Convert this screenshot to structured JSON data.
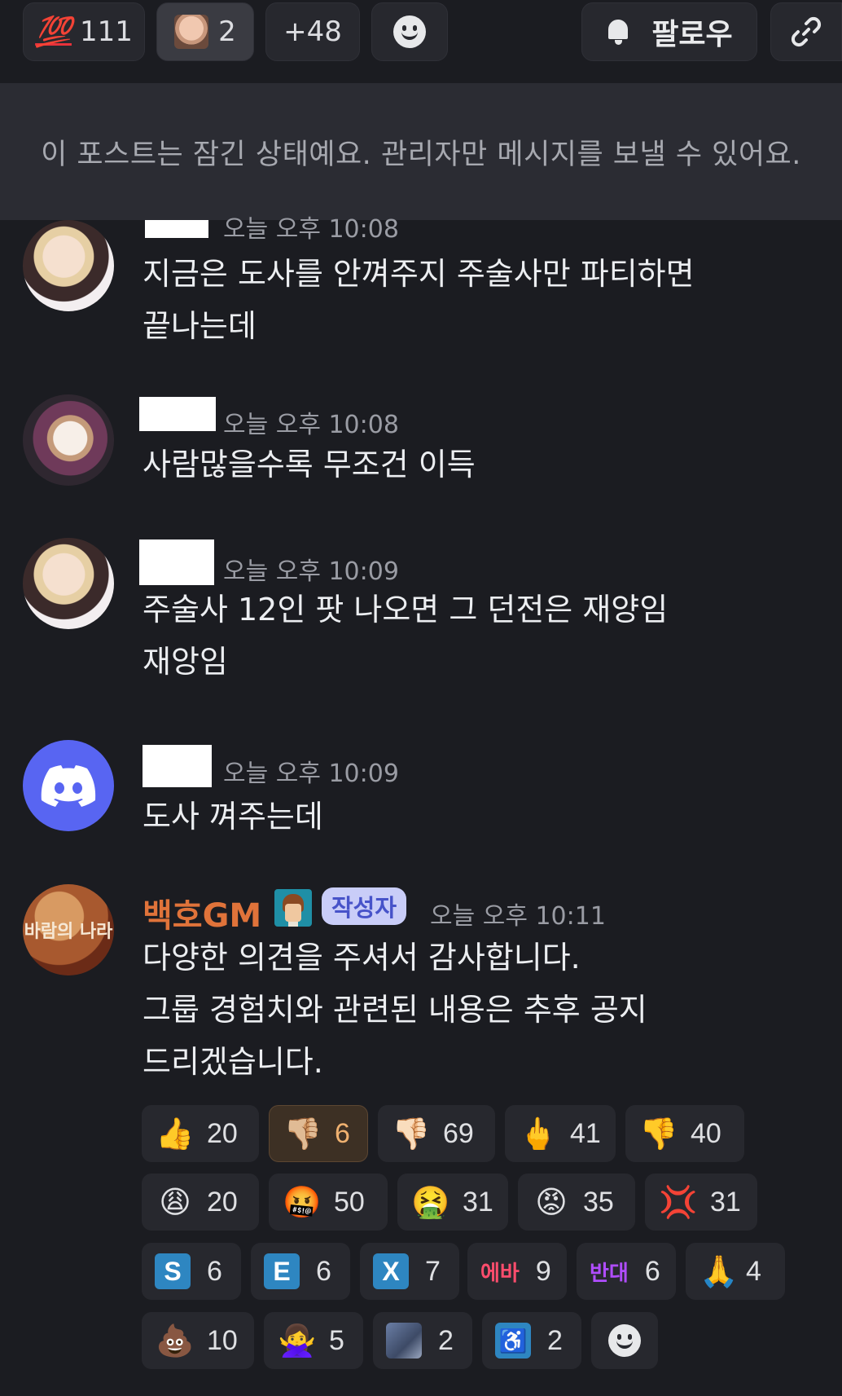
{
  "top_reactions": [
    {
      "emoji": "💯",
      "count": "111"
    },
    {
      "emoji": "face-photo",
      "count": "2"
    },
    {
      "emoji": "",
      "count": "+48"
    }
  ],
  "follow_label": "팔로우",
  "locked_notice": "이 포스트는 잠긴 상태예요. 관리자만 메시지를 보낼 수 있어요.",
  "messages": [
    {
      "time": "오늘 오후 10:08",
      "lines": [
        "지금은 도사를 안껴주지 주술사만 파티하면",
        "끝나는데"
      ]
    },
    {
      "time": "오늘 오후 10:08",
      "lines": [
        "사람많을수록 무조건 이득"
      ]
    },
    {
      "time": "오늘 오후 10:09",
      "lines": [
        "주술사 12인 팟 나오면 그 던전은 재양임",
        "재앙임"
      ]
    },
    {
      "time": "오늘 오후 10:09",
      "lines": [
        "도사 껴주는데"
      ]
    },
    {
      "author": "백호GM",
      "author_badge": "작성자",
      "avatar_text": "바람의 나라",
      "time": "오늘 오후 10:11",
      "lines": [
        "다양한 의견을 주셔서 감사합니다.",
        "그룹 경험치와 관련된 내용은 추후 공지",
        "드리겠습니다."
      ]
    }
  ],
  "reactions": [
    {
      "emoji": "👍",
      "count": "20"
    },
    {
      "emoji": "👎🏼",
      "count": "6"
    },
    {
      "emoji": "👎🏻",
      "count": "69"
    },
    {
      "emoji": "🖕",
      "count": "41"
    },
    {
      "emoji": "👎",
      "count": "40"
    },
    {
      "emoji": "😩",
      "count": "20"
    },
    {
      "emoji": "🤬",
      "count": "50"
    },
    {
      "emoji": "🤮",
      "count": "31"
    },
    {
      "emoji": "😡",
      "count": "35"
    },
    {
      "emoji": "💢",
      "count": "31"
    },
    {
      "emoji": "S",
      "count": "6"
    },
    {
      "emoji": "E",
      "count": "6"
    },
    {
      "emoji": "X",
      "count": "7"
    },
    {
      "emoji": "에바",
      "count": "9"
    },
    {
      "emoji": "반대",
      "count": "6"
    },
    {
      "emoji": "🙏",
      "count": "4"
    },
    {
      "emoji": "💩",
      "count": "10"
    },
    {
      "emoji": "🙅‍♀️",
      "count": "5"
    },
    {
      "emoji": "custom-image",
      "count": "2"
    },
    {
      "emoji": "♿",
      "count": "2"
    }
  ]
}
